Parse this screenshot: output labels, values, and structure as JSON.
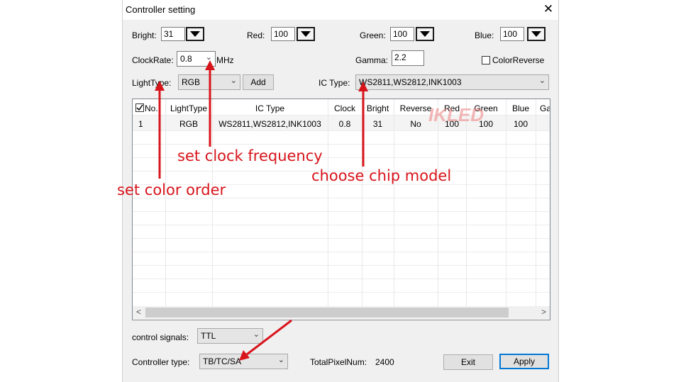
{
  "window": {
    "title": "Controller setting",
    "close_glyph": "✕"
  },
  "params": {
    "bright": {
      "label": "Bright:",
      "value": "31"
    },
    "red": {
      "label": "Red:",
      "value": "100"
    },
    "green": {
      "label": "Green:",
      "value": "100"
    },
    "blue": {
      "label": "Blue:",
      "value": "100"
    },
    "clockrate": {
      "label": "ClockRate:",
      "value": "0.8",
      "unit": "MHz"
    },
    "gamma": {
      "label": "Gamma:",
      "value": "2.2"
    },
    "colorreverse": {
      "label": "ColorReverse",
      "checked": false
    },
    "lighttype": {
      "label": "LightType:",
      "value": "RGB"
    },
    "add_label": "Add",
    "ictype": {
      "label": "IC Type:",
      "value": "WS2811,WS2812,INK1003"
    }
  },
  "table": {
    "headers": [
      "No.",
      "LightType",
      "IC Type",
      "Clock",
      "Bright",
      "Reverse",
      "Red",
      "Green",
      "Blue",
      "Ga"
    ],
    "rows": [
      [
        "1",
        "RGB",
        "WS2811,WS2812,INK1003",
        "0.8",
        "31",
        "No",
        "100",
        "100",
        "100",
        ""
      ]
    ]
  },
  "bottom": {
    "control_signals_label": "control signals:",
    "control_signals_value": "TTL",
    "controller_type_label": "Controller type:",
    "controller_type_value": "TB/TC/SA",
    "total_pixel_label": "TotalPixelNum:",
    "total_pixel_value": "2400",
    "exit_label": "Exit",
    "apply_label": "Apply"
  },
  "annotations": {
    "clock": "set clock frequency",
    "chip": "choose chip model",
    "color": "set color order",
    "watermark": "IKLED",
    "color_hex": "#d8141b"
  },
  "icons": [
    "close-icon",
    "dropdown-triangle-icon",
    "chevron-down-icon",
    "scroll-left-icon",
    "scroll-right-icon",
    "checkbox-icon"
  ]
}
